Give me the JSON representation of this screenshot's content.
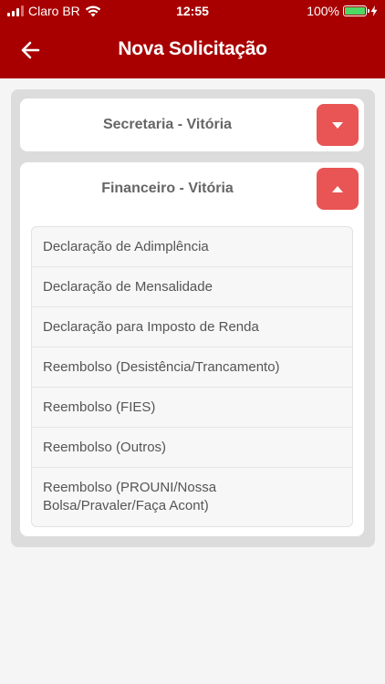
{
  "status_bar": {
    "carrier": "Claro BR",
    "time": "12:55",
    "battery": "100%"
  },
  "header": {
    "title": "Nova Solicitação",
    "back_icon": "arrow-left-icon"
  },
  "colors": {
    "header_bg": "#a80000",
    "accent_button": "#e95454",
    "battery_fill": "#4cd964"
  },
  "sections": [
    {
      "title": "Secretaria - Vitória",
      "expanded": false,
      "toggle_icon": "chevron-down-icon"
    },
    {
      "title": "Financeiro - Vitória",
      "expanded": true,
      "toggle_icon": "chevron-up-icon",
      "items": [
        "Declaração de Adimplência",
        "Declaração de Mensalidade",
        "Declaração para Imposto de Renda",
        "Reembolso (Desistência/Trancamento)",
        "Reembolso (FIES)",
        "Reembolso (Outros)",
        "Reembolso (PROUNI/Nossa Bolsa/Pravaler/Faça Acont)"
      ]
    }
  ]
}
